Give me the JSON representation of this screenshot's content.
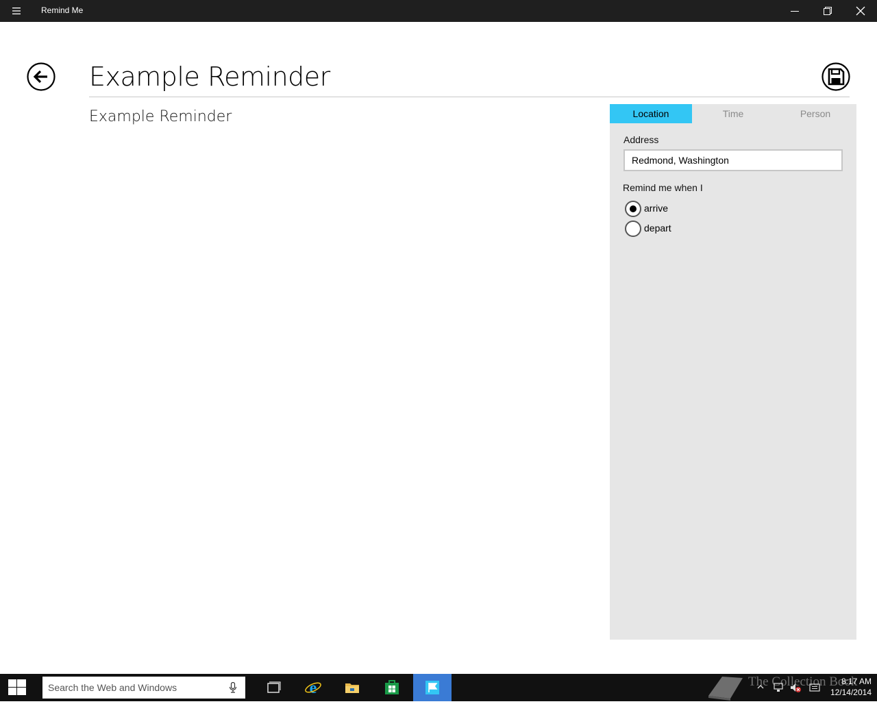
{
  "window": {
    "title": "Remind Me",
    "menu_icon": "hamburger-menu-icon",
    "controls": [
      "minimize-icon",
      "restore-icon",
      "close-icon"
    ]
  },
  "header": {
    "back_icon": "back-arrow-circle-icon",
    "title": "Example Reminder",
    "save_icon": "save-floppy-circle-icon"
  },
  "reminder": {
    "text": "Example Reminder"
  },
  "panel": {
    "tabs": [
      {
        "label": "Location",
        "active": true
      },
      {
        "label": "Time",
        "active": false
      },
      {
        "label": "Person",
        "active": false
      }
    ],
    "address_label": "Address",
    "address_value": "Redmond, Washington",
    "remind_when_label": "Remind me when I",
    "options": [
      {
        "label": "arrive",
        "selected": true
      },
      {
        "label": "depart",
        "selected": false
      }
    ]
  },
  "taskbar": {
    "search_placeholder": "Search the Web and Windows",
    "apps": [
      "task-view-icon",
      "internet-explorer-icon",
      "file-explorer-icon",
      "store-icon",
      "remind-me-app-icon"
    ],
    "active_app": "remind-me-app-icon",
    "watermark_text": "The Collection Book",
    "clock_time": "8:17 AM",
    "clock_date": "12/14/2014"
  },
  "colors": {
    "accent": "#33c6f4",
    "titlebar": "#1f1f1f",
    "panel": "#e6e6e6",
    "taskbar": "#111111",
    "active_task": "#3a7bd5"
  }
}
